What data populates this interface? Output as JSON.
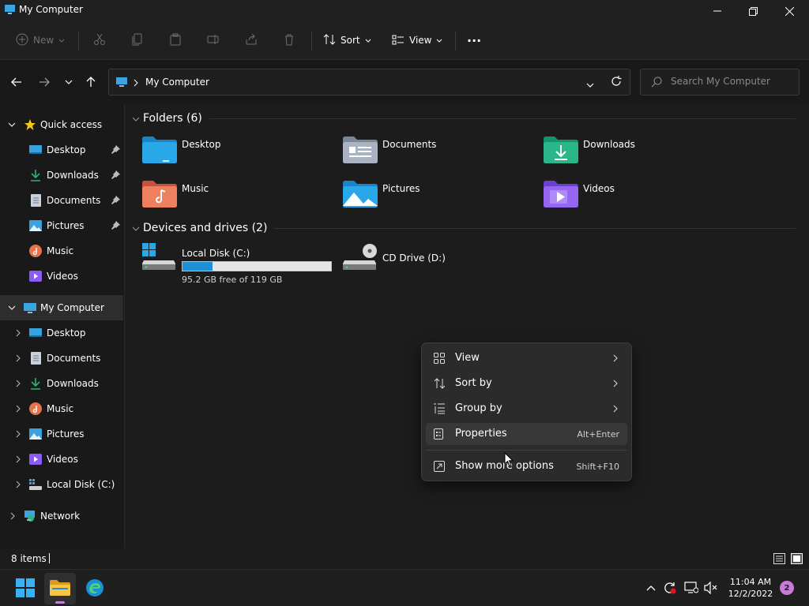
{
  "window": {
    "title": "My Computer"
  },
  "toolbar": {
    "new_label": "New",
    "sort_label": "Sort",
    "view_label": "View",
    "more_label": "···"
  },
  "address": {
    "crumb": "My Computer"
  },
  "search": {
    "placeholder": "Search My Computer"
  },
  "sidebar": {
    "quick_access": "Quick access",
    "quick_items": [
      "Desktop",
      "Downloads",
      "Documents",
      "Pictures",
      "Music",
      "Videos"
    ],
    "my_computer": "My Computer",
    "computer_items": [
      "Desktop",
      "Documents",
      "Downloads",
      "Music",
      "Pictures",
      "Videos",
      "Local Disk (C:)"
    ],
    "network": "Network"
  },
  "content": {
    "folders_header": "Folders (6)",
    "folders": [
      "Desktop",
      "Documents",
      "Downloads",
      "Music",
      "Pictures",
      "Videos"
    ],
    "drives_header": "Devices and drives (2)",
    "drives": [
      {
        "name": "Local Disk (C:)",
        "free": "95.2 GB free of 119 GB",
        "used_fraction": 0.2
      },
      {
        "name": "CD Drive (D:)"
      }
    ]
  },
  "context_menu": {
    "items": [
      {
        "label": "View"
      },
      {
        "label": "Sort by"
      },
      {
        "label": "Group by"
      },
      {
        "label": "Properties",
        "shortcut": "Alt+Enter"
      },
      {
        "label": "Show more options",
        "shortcut": "Shift+F10"
      }
    ]
  },
  "status": {
    "count": "8 items"
  },
  "taskbar": {
    "time": "11:04 AM",
    "date": "12/2/2022",
    "notifications": "2"
  },
  "colors": {
    "accent": "#1e90d6",
    "folder_blue": "#2aa7e8",
    "downloads_green": "#2bb673",
    "music_orange": "#e8734a",
    "videos_purple": "#8b5cf6"
  }
}
